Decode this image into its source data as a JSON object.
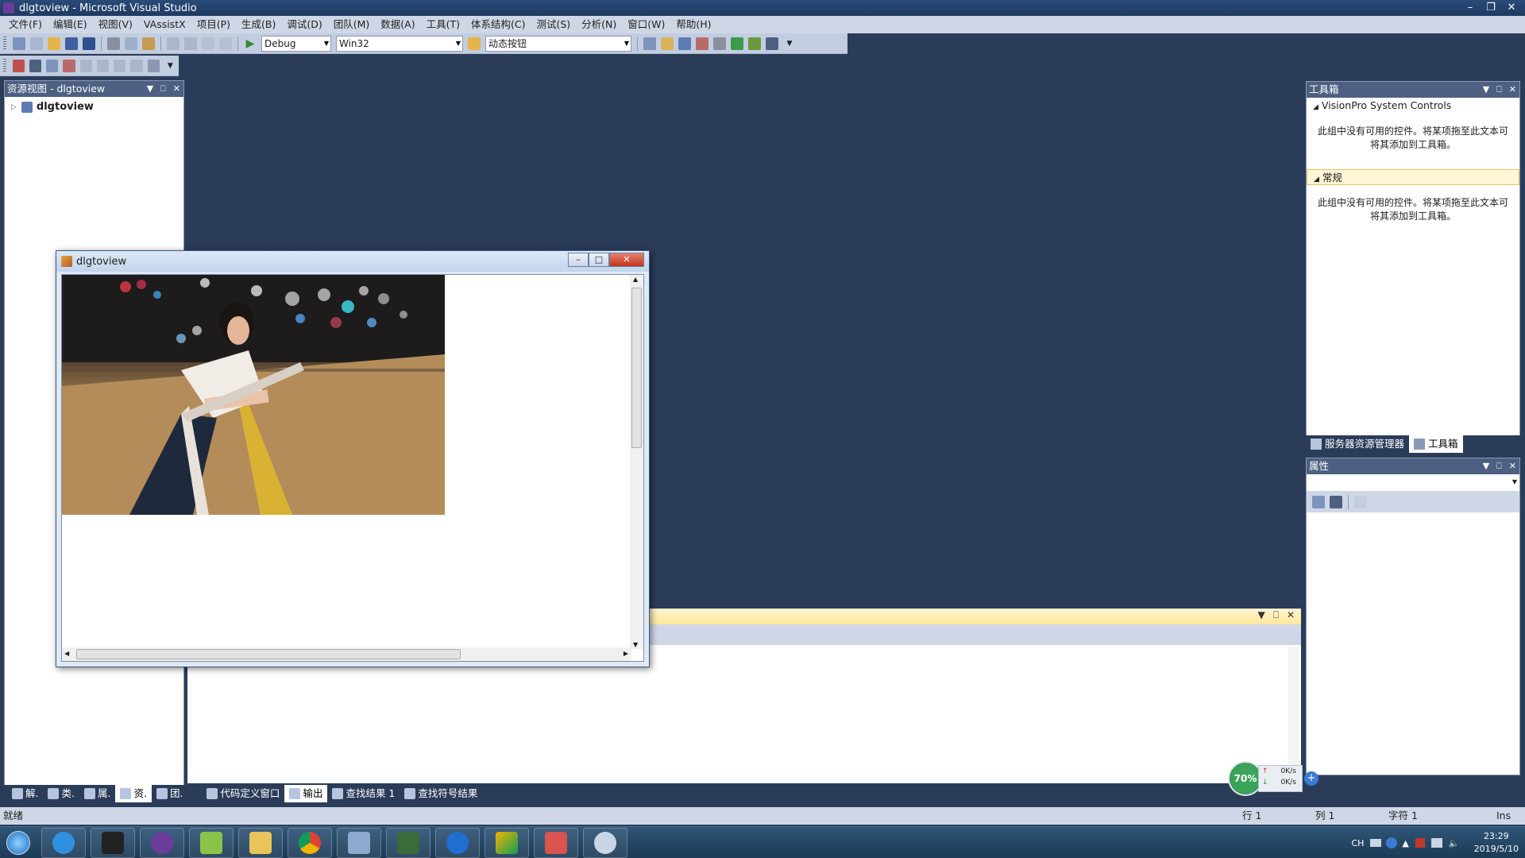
{
  "window": {
    "title": "dlgtoview - Microsoft Visual Studio"
  },
  "menu": [
    "文件(F)",
    "编辑(E)",
    "视图(V)",
    "VAssistX",
    "项目(P)",
    "生成(B)",
    "调试(D)",
    "团队(M)",
    "数据(A)",
    "工具(T)",
    "体系结构(C)",
    "测试(S)",
    "分析(N)",
    "窗口(W)",
    "帮助(H)"
  ],
  "toolbar": {
    "config": "Debug",
    "platform": "Win32",
    "find_combo": "动态按钮"
  },
  "resource_view": {
    "title": "资源视图 - dlgtoview",
    "root_node": "dlgtoview"
  },
  "bottom_tabs": [
    "解.",
    "类.",
    "属.",
    "资.",
    "团.",
    "代码定义窗口",
    "输出",
    "查找结果 1",
    "查找符号结果"
  ],
  "toolbox": {
    "title": "工具箱",
    "groups": [
      {
        "name": "VisionPro System Controls",
        "message": "此组中没有可用的控件。将某项拖至此文本可将其添加到工具箱。"
      },
      {
        "name": "常规",
        "message": "此组中没有可用的控件。将某项拖至此文本可将其添加到工具箱。"
      }
    ]
  },
  "right_tabs": [
    "服务器资源管理器",
    "工具箱"
  ],
  "properties": {
    "title": "属性"
  },
  "status": {
    "left": "就绪",
    "line": "行 1",
    "col": "列 1",
    "char": "字符 1",
    "mode": "Ins"
  },
  "dialog": {
    "title": "dlgtoview"
  },
  "net_widget": {
    "percent": "70%",
    "up": "0K/s",
    "down": "0K/s"
  },
  "taskbar": {
    "lang": "CH",
    "time": "23:29",
    "date": "2019/5/10"
  },
  "colors": {
    "ide_bg": "#2b3c59",
    "panel_head": "#4d6082",
    "taskbar": "#2f5577",
    "close_red": "#c1331c",
    "net_green": "#3aa55a"
  }
}
